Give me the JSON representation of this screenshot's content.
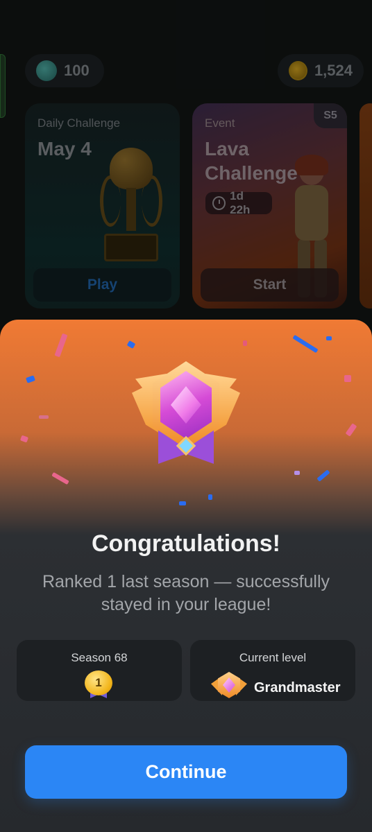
{
  "header": {
    "brains": {
      "icon": "brain-icon",
      "value": "100"
    },
    "coins": {
      "icon": "coin-icon",
      "value": "1,524"
    }
  },
  "cards": {
    "daily": {
      "kicker": "Daily Challenge",
      "date": "May 4",
      "button": "Play",
      "image": "trophy-image"
    },
    "event": {
      "kicker": "Event",
      "title_line1": "Lava",
      "title_line2": "Challenge",
      "timer": "1d 22h",
      "season_tag": "S5",
      "button": "Start",
      "image": "adventurer-image"
    }
  },
  "modal": {
    "title": "Congratulations!",
    "subtitle": "Ranked 1 last season — successfully stayed in your league!",
    "badge_icon": "grandmaster-badge-icon",
    "season": {
      "label": "Season 68",
      "rank": "1"
    },
    "level": {
      "label": "Current level",
      "name": "Grandmaster"
    },
    "continue_label": "Continue"
  },
  "colors": {
    "accent_blue": "#2b86f5",
    "sheet_orange": "#f07a34",
    "sheet_dark": "#26292d",
    "badge_purple": "#d54bd6",
    "badge_gold": "#f08a24"
  }
}
